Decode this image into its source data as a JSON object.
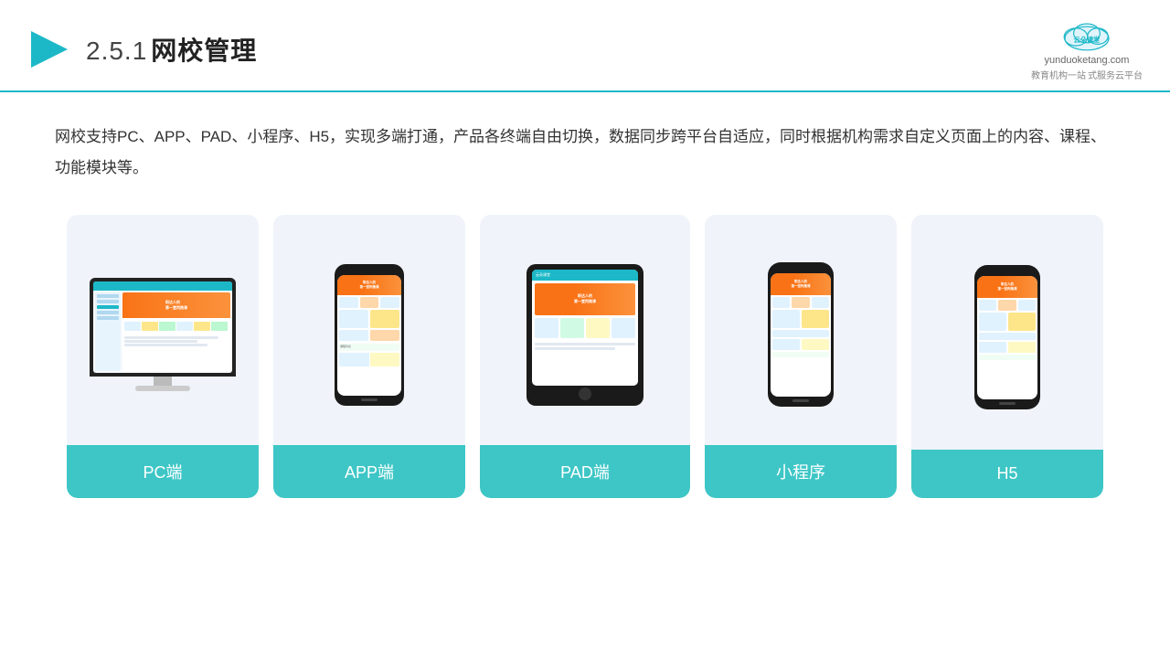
{
  "header": {
    "section_number": "2.5.1",
    "title": "网校管理",
    "logo_name": "云朵课堂",
    "logo_url": "yunduoketang.com",
    "logo_tagline1": "教育机构一站",
    "logo_tagline2": "式服务云平台"
  },
  "description": {
    "text": "网校支持PC、APP、PAD、小程序、H5，实现多端打通，产品各终端自由切换，数据同步跨平台自适应，同时根据机构需求自定义页面上的内容、课程、功能模块等。"
  },
  "cards": [
    {
      "id": "pc",
      "label": "PC端",
      "type": "monitor"
    },
    {
      "id": "app",
      "label": "APP端",
      "type": "phone"
    },
    {
      "id": "pad",
      "label": "PAD端",
      "type": "tablet"
    },
    {
      "id": "miniapp",
      "label": "小程序",
      "type": "phone-new"
    },
    {
      "id": "h5",
      "label": "H5",
      "type": "phone-new"
    }
  ],
  "colors": {
    "accent": "#1db8c8",
    "card_bg": "#f0f4fa",
    "label_bg": "#3ec6c6",
    "border_bottom": "#1db8c8"
  }
}
